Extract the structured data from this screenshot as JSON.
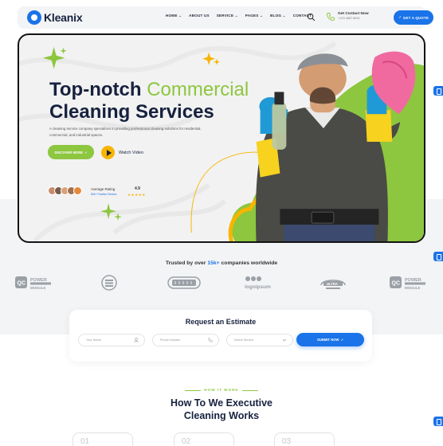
{
  "header": {
    "logo_text": "Kleanix",
    "nav": [
      "HOME",
      "ABOUT US",
      "SERVICE",
      "PAGES",
      "BLOG",
      "CONTACT"
    ],
    "nav_dropdowns": [
      true,
      false,
      true,
      true,
      true,
      false
    ],
    "contact_label": "Get Contact Now",
    "contact_phone": "+123 4567 8910",
    "quote_button": "GET A QUOTE"
  },
  "hero": {
    "title_line1_plain": "Top-notch",
    "title_line1_accent": "Commercial",
    "title_line2": "Cleaning Services",
    "description": "A cleaning service company specializes in providing professional cleaning solutions for residential, commercial, and industrial spaces.",
    "discover_button": "DISCOVER MORE",
    "watch_video": "Watch Video",
    "rating_label": "Average Rating",
    "rating_sub": "80k+ Positive Review",
    "rating_value": "4.9",
    "stars": 5
  },
  "trusted": {
    "prefix": "Trusted by over",
    "highlight": "15k+",
    "suffix": "companies worldwide"
  },
  "brands": [
    "QC POWER MODULE",
    "laurel",
    "keyboard",
    "logoipsum",
    "ULTRA",
    "QC POWER MODULE"
  ],
  "estimate": {
    "title": "Request an Estimate",
    "name_placeholder": "Your Name",
    "phone_placeholder": "Phone Number",
    "service_placeholder": "Select Service",
    "submit_button": "SUBMIT NOW"
  },
  "how_it_works": {
    "tag": "HOW IT WORK",
    "title_line1": "How To We Executive",
    "title_line2": "Cleaning Works",
    "steps": [
      "01",
      "02",
      "03"
    ]
  },
  "colors": {
    "primary": "#1a73e8",
    "accent_green": "#8dc63f",
    "accent_yellow": "#f7b500",
    "dark": "#16213e"
  }
}
